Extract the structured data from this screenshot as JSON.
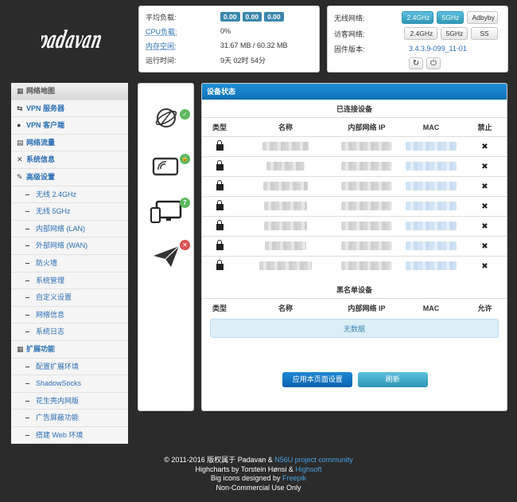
{
  "logo_text": "padavan",
  "status": {
    "load_label": "平均负载:",
    "load": [
      "0.00",
      "0.00",
      "0.00"
    ],
    "cpu_label": "CPU负载:",
    "cpu_value": "0%",
    "mem_label": "内存空闲:",
    "mem_value": "31.67 MB / 60.32 MB",
    "uptime_label": "运行时间:",
    "uptime_value": "9天 02时 54分"
  },
  "wireless": {
    "wl_label": "无线网络:",
    "wl_buttons": [
      "2.4GHz",
      "5GHz",
      "Adbyby"
    ],
    "guest_label": "访客网络:",
    "guest_buttons": [
      "2.4GHz",
      "5GHz",
      "SS"
    ],
    "fw_label": "固件版本:",
    "fw_value": "3.4.3.9-099_11-01"
  },
  "sidebar": {
    "items": [
      {
        "label": "网络地图",
        "kind": "header",
        "icon": "map-icon",
        "glyph": "▦"
      },
      {
        "label": "VPN 服务器",
        "kind": "top",
        "icon": "vpn-server-icon",
        "glyph": "⇆"
      },
      {
        "label": "VPN 客户端",
        "kind": "top",
        "icon": "globe-icon",
        "glyph": "●"
      },
      {
        "label": "网络流量",
        "kind": "top",
        "icon": "chart-icon",
        "glyph": "▤"
      },
      {
        "label": "系统信息",
        "kind": "top",
        "icon": "shuffle-icon",
        "glyph": "✕"
      },
      {
        "label": "高级设置",
        "kind": "group",
        "icon": "wrench-icon",
        "glyph": "✎"
      },
      {
        "label": "无线 2.4GHz",
        "kind": "sub"
      },
      {
        "label": "无线 5GHz",
        "kind": "sub"
      },
      {
        "label": "内部网络 (LAN)",
        "kind": "sub"
      },
      {
        "label": "外部网络 (WAN)",
        "kind": "sub"
      },
      {
        "label": "防火墙",
        "kind": "sub"
      },
      {
        "label": "系统管理",
        "kind": "sub"
      },
      {
        "label": "自定义设置",
        "kind": "sub"
      },
      {
        "label": "网络信息",
        "kind": "sub"
      },
      {
        "label": "系统日志",
        "kind": "sub"
      },
      {
        "label": "扩展功能",
        "kind": "group",
        "icon": "grid-icon",
        "glyph": "▦"
      },
      {
        "label": "配置扩展环境",
        "kind": "sub"
      },
      {
        "label": "ShadowSocks",
        "kind": "sub"
      },
      {
        "label": "花生壳内网版",
        "kind": "sub"
      },
      {
        "label": "广告屏蔽功能",
        "kind": "sub"
      },
      {
        "label": "搭建 Web 环境",
        "kind": "sub"
      }
    ]
  },
  "device_tabs": {
    "internet_badge": "✓",
    "wireless_badge": "🔒",
    "clients_badge": "7",
    "usb_badge": "✕"
  },
  "main": {
    "title": "设备状态",
    "connected_title": "已连接设备",
    "cols": [
      "类型",
      "名称",
      "内部网络 IP",
      "MAC",
      "禁止"
    ],
    "row_count": 7,
    "blacklist_title": "黑名单设备",
    "bl_cols": [
      "类型",
      "名称",
      "内部网络 IP",
      "MAC",
      "允许"
    ],
    "no_data": "无数据",
    "apply_label": "应用本页面设置",
    "refresh_label": "刷新"
  },
  "footer": {
    "line1_pre": "© 2011-2016 版权属于 Padavan & ",
    "line1_link": "N56U project community",
    "line2_pre": "Highcharts by Torstein Hønsi & ",
    "line2_link": "Highsoft",
    "line3_pre": "Big icons designed by ",
    "line3_link": "Freepik",
    "line4": "Non-Commercial Use Only"
  },
  "colors": {
    "background": "#2b2b2b",
    "accent": "#1f90d8",
    "ok": "#5cb85c",
    "error": "#d9534f"
  }
}
